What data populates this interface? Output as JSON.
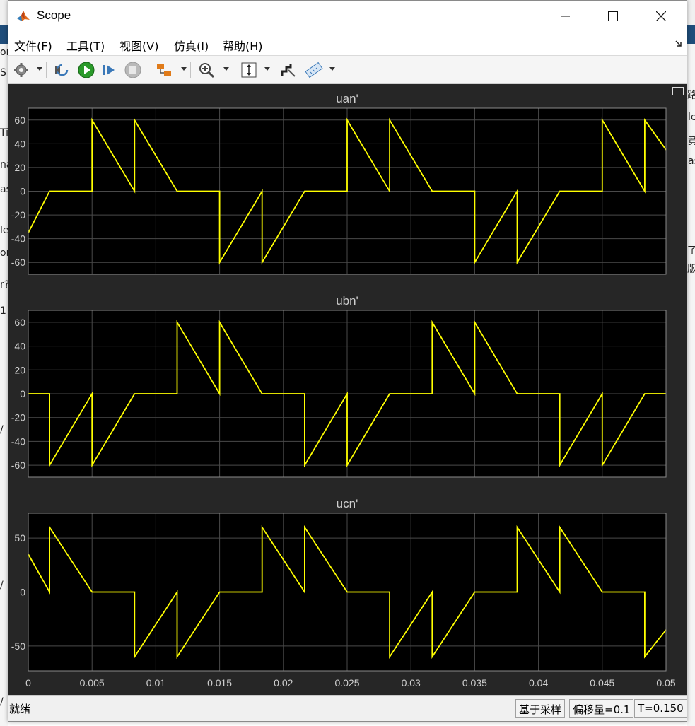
{
  "background": {
    "fragments_left": [
      "or",
      "S",
      "Ti",
      "na",
      "as",
      "leg",
      "on",
      "r?",
      "1",
      "/",
      "/",
      "/"
    ],
    "fragments_right": [
      "路",
      "le",
      "竟",
      "as",
      "了",
      "版"
    ]
  },
  "window": {
    "title": "Scope",
    "icon": "matlab-icon"
  },
  "menu": {
    "items": [
      {
        "label": "文件(F)",
        "name": "menu-file"
      },
      {
        "label": "工具(T)",
        "name": "menu-tools"
      },
      {
        "label": "视图(V)",
        "name": "menu-view"
      },
      {
        "label": "仿真(I)",
        "name": "menu-simulation"
      },
      {
        "label": "帮助(H)",
        "name": "menu-help"
      }
    ]
  },
  "toolbar": {
    "icons": [
      "settings-gear-icon",
      "step-back-icon",
      "run-icon",
      "step-forward-icon",
      "stop-icon",
      "triggers-icon",
      "zoom-in-icon",
      "scale-axes-icon",
      "style-icon",
      "measurements-icon"
    ]
  },
  "plots": [
    {
      "title": "uan'",
      "yticks": [
        "60",
        "40",
        "20",
        "0",
        "-20",
        "-40",
        "-60"
      ]
    },
    {
      "title": "ubn'",
      "yticks": [
        "60",
        "40",
        "20",
        "0",
        "-20",
        "-40",
        "-60"
      ]
    },
    {
      "title": "ucn'",
      "yticks": [
        "50",
        "0",
        "-50"
      ]
    }
  ],
  "xticks": [
    "0",
    "0.005",
    "0.01",
    "0.015",
    "0.02",
    "0.025",
    "0.03",
    "0.035",
    "0.04",
    "0.045",
    "0.05"
  ],
  "chart_data": [
    {
      "type": "line",
      "title": "uan'",
      "xlim": [
        0,
        0.05
      ],
      "ylim": [
        -70,
        70
      ],
      "yticks": [
        60,
        40,
        20,
        0,
        -20,
        -40,
        -60
      ],
      "grid": true,
      "line_color": "#ffff00",
      "x": [
        0,
        0.00167,
        0.005,
        0.005,
        0.00833,
        0.00833,
        0.01167,
        0.015,
        0.015,
        0.01833,
        0.01833,
        0.02167,
        0.025,
        0.025,
        0.02833,
        0.02833,
        0.03167,
        0.035,
        0.035,
        0.03833,
        0.03833,
        0.04167,
        0.045,
        0.045,
        0.04833,
        0.04833,
        0.05
      ],
      "y": [
        -35,
        0,
        0,
        60,
        0,
        60,
        0,
        0,
        -60,
        0,
        -60,
        0,
        0,
        60,
        0,
        60,
        0,
        0,
        -60,
        0,
        -60,
        0,
        0,
        60,
        0,
        60,
        35
      ]
    },
    {
      "type": "line",
      "title": "ubn'",
      "xlim": [
        0,
        0.05
      ],
      "ylim": [
        -70,
        70
      ],
      "yticks": [
        60,
        40,
        20,
        0,
        -20,
        -40,
        -60
      ],
      "grid": true,
      "line_color": "#ffff00",
      "x": [
        0,
        0.00167,
        0.00167,
        0.005,
        0.005,
        0.00833,
        0.01167,
        0.01167,
        0.015,
        0.015,
        0.01833,
        0.02167,
        0.02167,
        0.025,
        0.025,
        0.02833,
        0.03167,
        0.03167,
        0.035,
        0.035,
        0.03833,
        0.04167,
        0.04167,
        0.045,
        0.045,
        0.04833,
        0.05
      ],
      "y": [
        0,
        0,
        -60,
        0,
        -60,
        0,
        0,
        60,
        0,
        60,
        0,
        0,
        -60,
        0,
        -60,
        0,
        0,
        60,
        0,
        60,
        0,
        0,
        -60,
        0,
        -60,
        0,
        0
      ]
    },
    {
      "type": "line",
      "title": "ucn'",
      "xlim": [
        0,
        0.05
      ],
      "ylim": [
        -73,
        73
      ],
      "yticks": [
        50,
        0,
        -50
      ],
      "grid": true,
      "line_color": "#ffff00",
      "x": [
        0,
        0.00167,
        0.00167,
        0.005,
        0.00833,
        0.00833,
        0.01167,
        0.01167,
        0.015,
        0.01833,
        0.01833,
        0.02167,
        0.02167,
        0.025,
        0.02833,
        0.02833,
        0.03167,
        0.03167,
        0.035,
        0.03833,
        0.03833,
        0.04167,
        0.04167,
        0.045,
        0.04833,
        0.04833,
        0.05
      ],
      "y": [
        35,
        0,
        60,
        0,
        0,
        -60,
        0,
        -60,
        0,
        0,
        60,
        0,
        60,
        0,
        0,
        -60,
        0,
        -60,
        0,
        0,
        60,
        0,
        60,
        0,
        0,
        -60,
        -35
      ]
    }
  ],
  "status": {
    "left": "就绪",
    "sampling": "基于采样",
    "offset": "偏移量=0.1",
    "time": "T=0.150"
  }
}
